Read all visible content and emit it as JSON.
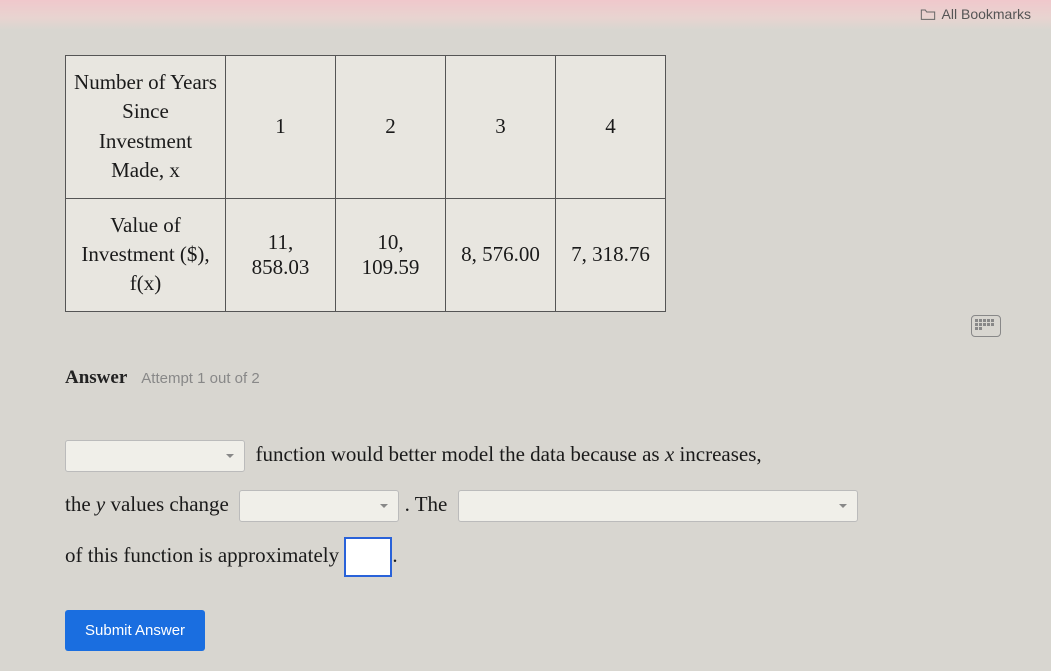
{
  "bookmarks_label": "All Bookmarks",
  "table": {
    "row1_header": "Number of Years\nSince Investment\nMade, x",
    "row1_values": [
      "1",
      "2",
      "3",
      "4"
    ],
    "row2_header": "Value of\nInvestment ($),\nf(x)",
    "row2_values": [
      "11, 858.03",
      "10, 109.59",
      "8, 576.00",
      "7, 318.76"
    ]
  },
  "answer_label": "Answer",
  "attempt_label": "Attempt 1 out of 2",
  "sentence": {
    "part1": "function would better model the data because as",
    "var_x": "x",
    "part2": "increases,",
    "part3": "the",
    "var_y": "y",
    "part4": "values change",
    "part5": ". The",
    "part6": "of this function is approximately",
    "part7": "."
  },
  "submit_label": "Submit Answer"
}
